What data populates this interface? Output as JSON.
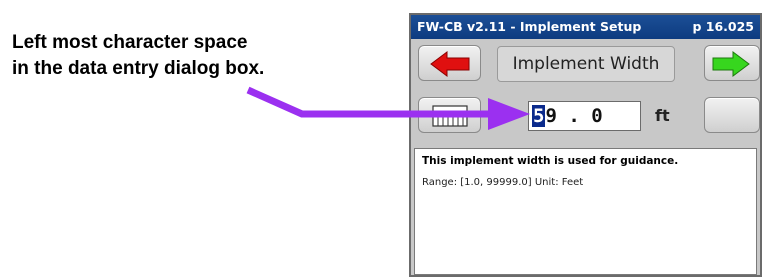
{
  "callout": {
    "line1": "Left most character space",
    "line2": "in the data entry dialog box."
  },
  "device": {
    "title": "FW-CB v2.11 - Implement Setup",
    "page": "p 16.025",
    "dialog_title": "Implement Width",
    "entry": {
      "cursor_char": "5",
      "rest": "9 . 0"
    },
    "unit": "ft",
    "info": {
      "heading": "This implement width is used for guidance.",
      "range": "Range: [1.0, 99999.0]  Unit: Feet"
    },
    "icons": {
      "back": "red-left-arrow-icon",
      "next": "green-right-arrow-icon",
      "keypad": "keypad-icon"
    }
  },
  "colors": {
    "title_bar": "#0d3b80",
    "pointer_arrow": "#9b30f0",
    "back_arrow": "#e01010",
    "next_arrow": "#37d61e",
    "cursor_highlight": "#0a2a8c"
  }
}
